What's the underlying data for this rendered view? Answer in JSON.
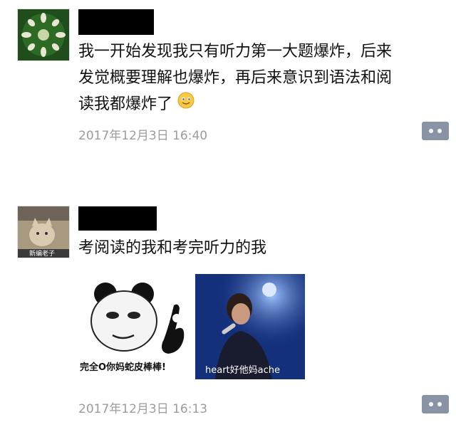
{
  "post1": {
    "text_lines": [
      "我一开始发现我只有听力第一大题爆炸，后来",
      "发觉概要理解也爆炸，再后来意识到语法和阅",
      "读我都爆炸了"
    ],
    "timestamp": "2017年12月3日 16:40"
  },
  "post2": {
    "text": "考阅读的我和考完听力的我",
    "avatar_caption": "新编老子",
    "image1_caption": "完全O你妈蛇皮棒棒!",
    "image2_caption": "heart好他妈ache",
    "timestamp": "2017年12月3日 16:13"
  },
  "icons": {
    "emoji": "smile-emoji-icon",
    "comment": "comment-dots-icon"
  },
  "colors": {
    "timestamp": "#9b9b9b",
    "comment_button": "#8a93a6"
  }
}
